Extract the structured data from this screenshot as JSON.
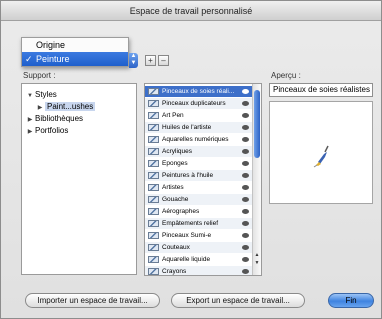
{
  "window": {
    "title": "Espace de travail personnalisé"
  },
  "workspace_menu": {
    "items": [
      {
        "label": "Origine",
        "selected": false
      },
      {
        "label": "Peinture",
        "selected": true
      }
    ],
    "check_mark": "✓"
  },
  "toolbar": {
    "add_label": "+",
    "remove_label": "–"
  },
  "support": {
    "label": "Support :",
    "tree": [
      {
        "label": "Styles",
        "expanded": true
      },
      {
        "label": "Paint...ushes",
        "selected": true
      },
      {
        "label": "Bibliothèques",
        "expanded": false
      },
      {
        "label": "Portfolios",
        "expanded": false
      }
    ]
  },
  "brushes": [
    {
      "label": "Pinceaux de soies réali...",
      "selected": true
    },
    {
      "label": "Pinceaux duplicateurs"
    },
    {
      "label": "Art Pen"
    },
    {
      "label": "Huiles de l'artiste"
    },
    {
      "label": "Aquarelles numériques"
    },
    {
      "label": "Acryliques"
    },
    {
      "label": "Eponges"
    },
    {
      "label": "Peintures à l'huile"
    },
    {
      "label": "Artistes"
    },
    {
      "label": "Gouache"
    },
    {
      "label": "Aérographes"
    },
    {
      "label": "Empâtements relief"
    },
    {
      "label": "Pinceaux Sumi-e"
    },
    {
      "label": "Couteaux"
    },
    {
      "label": "Aquarelle liquide"
    },
    {
      "label": "Crayons"
    }
  ],
  "preview": {
    "label": "Aperçu :",
    "value": "Pinceaux de soies réalistes"
  },
  "buttons": {
    "import": "Importer un espace de travail...",
    "export": "Export un espace de travail...",
    "done": "Fin"
  }
}
